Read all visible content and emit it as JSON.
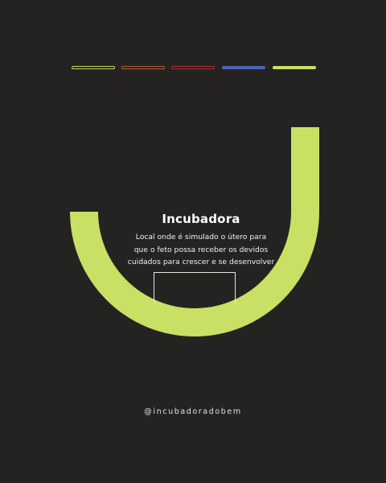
{
  "progress": {
    "total": 5,
    "current": 5,
    "colors": [
      "#c4d96a",
      "#b35a3a",
      "#a4302e",
      "#4f63b5",
      "#c8e064"
    ]
  },
  "content": {
    "title": "Incubadora",
    "description_lines": [
      "Local onde é simulado o útero para",
      "que o feto possa receber os devidos",
      "cuidados para crescer e se desenvolver"
    ]
  },
  "footer": {
    "handle": "@incubadoradobem"
  },
  "colors": {
    "background": "#252322",
    "accent": "#c8e064",
    "text": "#ffffff"
  }
}
